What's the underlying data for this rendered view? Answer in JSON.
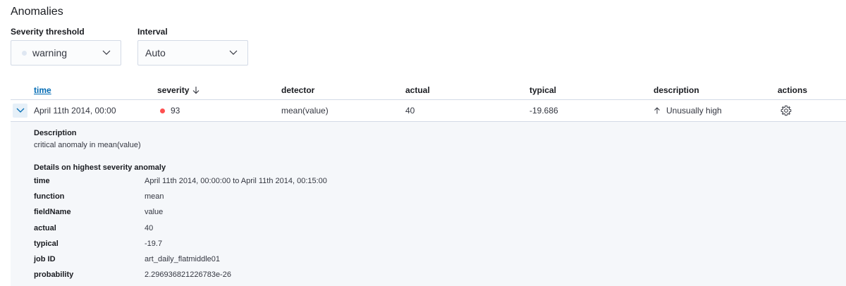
{
  "header": {
    "title": "Anomalies"
  },
  "controls": {
    "severity": {
      "label": "Severity threshold",
      "value": "warning",
      "dot_color": "#dfe7f2"
    },
    "interval": {
      "label": "Interval",
      "value": "Auto"
    }
  },
  "table": {
    "columns": {
      "time": "time",
      "severity": "severity",
      "detector": "detector",
      "actual": "actual",
      "typical": "typical",
      "description": "description",
      "actions": "actions"
    },
    "sort_icon": "arrow-down-icon",
    "rows": [
      {
        "time": "April 11th 2014, 00:00",
        "severity": "93",
        "severity_color": "#fe5050",
        "detector": "mean(value)",
        "actual": "40",
        "typical": "-19.686",
        "description": "Unusually high",
        "description_icon": "arrow-up-icon",
        "action_icon": "gear-icon"
      }
    ]
  },
  "details": {
    "description_heading": "Description",
    "description_text": "critical anomaly in mean(value)",
    "highest_heading": "Details on highest severity anomaly",
    "fields": [
      {
        "key": "time",
        "value": "April 11th 2014, 00:00:00 to April 11th 2014, 00:15:00"
      },
      {
        "key": "function",
        "value": "mean"
      },
      {
        "key": "fieldName",
        "value": "value"
      },
      {
        "key": "actual",
        "value": "40"
      },
      {
        "key": "typical",
        "value": "-19.7"
      },
      {
        "key": "job ID",
        "value": "art_daily_flatmiddle01"
      },
      {
        "key": "probability",
        "value": "2.296936821226783e-26"
      }
    ]
  }
}
